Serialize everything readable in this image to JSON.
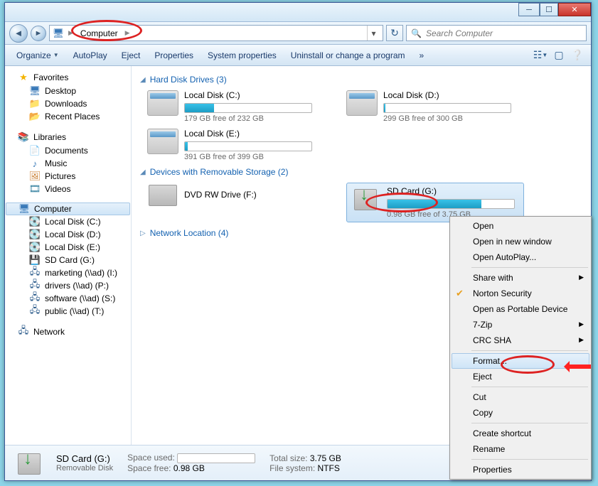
{
  "breadcrumb": {
    "root_icon": "computer-icon",
    "root": "Computer"
  },
  "search": {
    "placeholder": "Search Computer"
  },
  "toolbar": {
    "organize": "Organize",
    "autoplay": "AutoPlay",
    "eject": "Eject",
    "properties": "Properties",
    "system_properties": "System properties",
    "uninstall": "Uninstall or change a program",
    "more": "»"
  },
  "sidebar": {
    "favorites": {
      "label": "Favorites",
      "items": [
        "Desktop",
        "Downloads",
        "Recent Places"
      ]
    },
    "libraries": {
      "label": "Libraries",
      "items": [
        "Documents",
        "Music",
        "Pictures",
        "Videos"
      ]
    },
    "computer": {
      "label": "Computer",
      "items": [
        "Local Disk (C:)",
        "Local Disk (D:)",
        "Local Disk (E:)",
        "SD Card (G:)",
        "marketing (\\\\ad) (I:)",
        "drivers (\\\\ad) (P:)",
        "software (\\\\ad) (S:)",
        "public (\\\\ad) (T:)"
      ]
    },
    "network": {
      "label": "Network"
    }
  },
  "sections": {
    "hdd": {
      "title": "Hard Disk Drives (3)",
      "drives": [
        {
          "name": "Local Disk (C:)",
          "free": "179 GB free of 232 GB",
          "pct": 23
        },
        {
          "name": "Local Disk (D:)",
          "free": "299 GB free of 300 GB",
          "pct": 1
        },
        {
          "name": "Local Disk (E:)",
          "free": "391 GB free of 399 GB",
          "pct": 2
        }
      ]
    },
    "removable": {
      "title": "Devices with Removable Storage (2)",
      "drives": [
        {
          "name": "DVD RW Drive (F:)",
          "free": "",
          "pct": null
        },
        {
          "name": "SD Card (G:)",
          "free": "0.98 GB free of 3.75 GB",
          "pct": 74,
          "selected": true
        }
      ]
    },
    "network": {
      "title": "Network Location (4)"
    }
  },
  "context_menu": {
    "items": [
      {
        "label": "Open"
      },
      {
        "label": "Open in new window"
      },
      {
        "label": "Open AutoPlay..."
      },
      {
        "sep": true
      },
      {
        "label": "Share with",
        "sub": true
      },
      {
        "label": "Norton Security",
        "icon": "✓"
      },
      {
        "label": "Open as Portable Device"
      },
      {
        "label": "7-Zip",
        "sub": true
      },
      {
        "label": "CRC SHA",
        "sub": true
      },
      {
        "sep": true
      },
      {
        "label": "Format...",
        "selected": true
      },
      {
        "label": "Eject"
      },
      {
        "sep": true
      },
      {
        "label": "Cut"
      },
      {
        "label": "Copy"
      },
      {
        "sep": true
      },
      {
        "label": "Create shortcut"
      },
      {
        "label": "Rename"
      },
      {
        "sep": true
      },
      {
        "label": "Properties"
      }
    ]
  },
  "status": {
    "name": "SD Card (G:)",
    "subtitle": "Removable Disk",
    "space_used_label": "Space used:",
    "space_free_label": "Space free:",
    "space_free": "0.98 GB",
    "total_label": "Total size:",
    "total": "3.75 GB",
    "fs_label": "File system:",
    "fs": "NTFS"
  }
}
